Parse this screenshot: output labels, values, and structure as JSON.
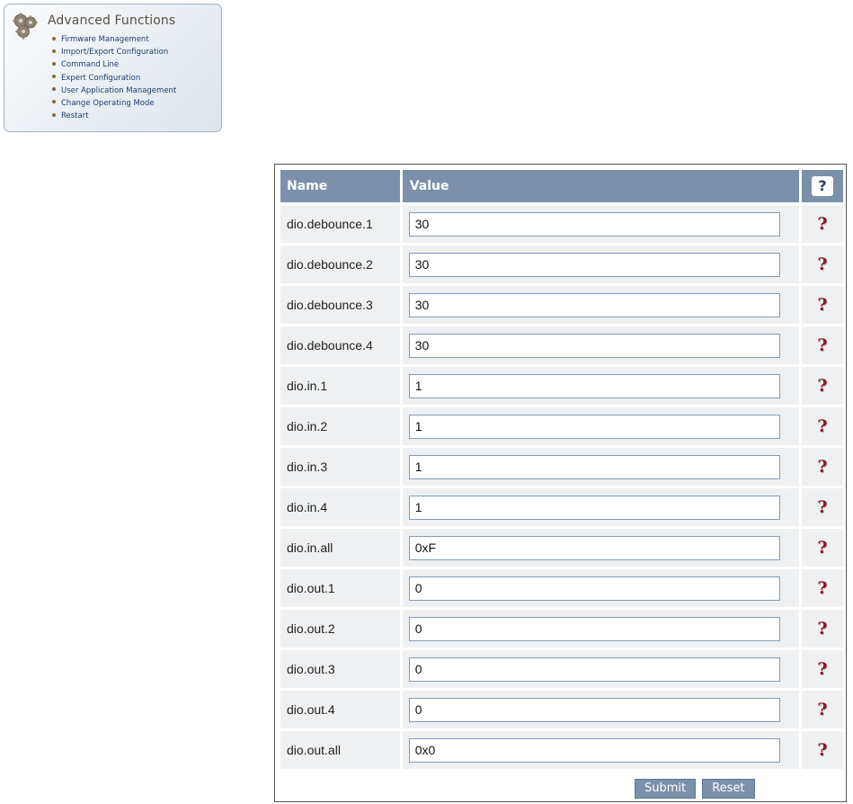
{
  "panel": {
    "title": "Advanced Functions",
    "icon": "gears-icon",
    "links": [
      "Firmware Management",
      "Import/Export Configuration",
      "Command Line",
      "Expert Configuration",
      "User Application Management",
      "Change Operating Mode",
      "Restart"
    ]
  },
  "table": {
    "headers": {
      "name": "Name",
      "value": "Value",
      "help": "?"
    },
    "rows": [
      {
        "name": "dio.debounce.1",
        "value": "30"
      },
      {
        "name": "dio.debounce.2",
        "value": "30"
      },
      {
        "name": "dio.debounce.3",
        "value": "30"
      },
      {
        "name": "dio.debounce.4",
        "value": "30"
      },
      {
        "name": "dio.in.1",
        "value": "1"
      },
      {
        "name": "dio.in.2",
        "value": "1"
      },
      {
        "name": "dio.in.3",
        "value": "1"
      },
      {
        "name": "dio.in.4",
        "value": "1"
      },
      {
        "name": "dio.in.all",
        "value": "0xF"
      },
      {
        "name": "dio.out.1",
        "value": "0"
      },
      {
        "name": "dio.out.2",
        "value": "0"
      },
      {
        "name": "dio.out.3",
        "value": "0"
      },
      {
        "name": "dio.out.4",
        "value": "0"
      },
      {
        "name": "dio.out.all",
        "value": "0x0"
      }
    ],
    "help_glyph": "?"
  },
  "buttons": {
    "submit": "Submit",
    "reset": "Reset"
  },
  "colors": {
    "header_bg": "#7b91ab",
    "row_bg": "#eef0f2",
    "help_red": "#8d1722",
    "panel_border": "#9fb3c6"
  }
}
